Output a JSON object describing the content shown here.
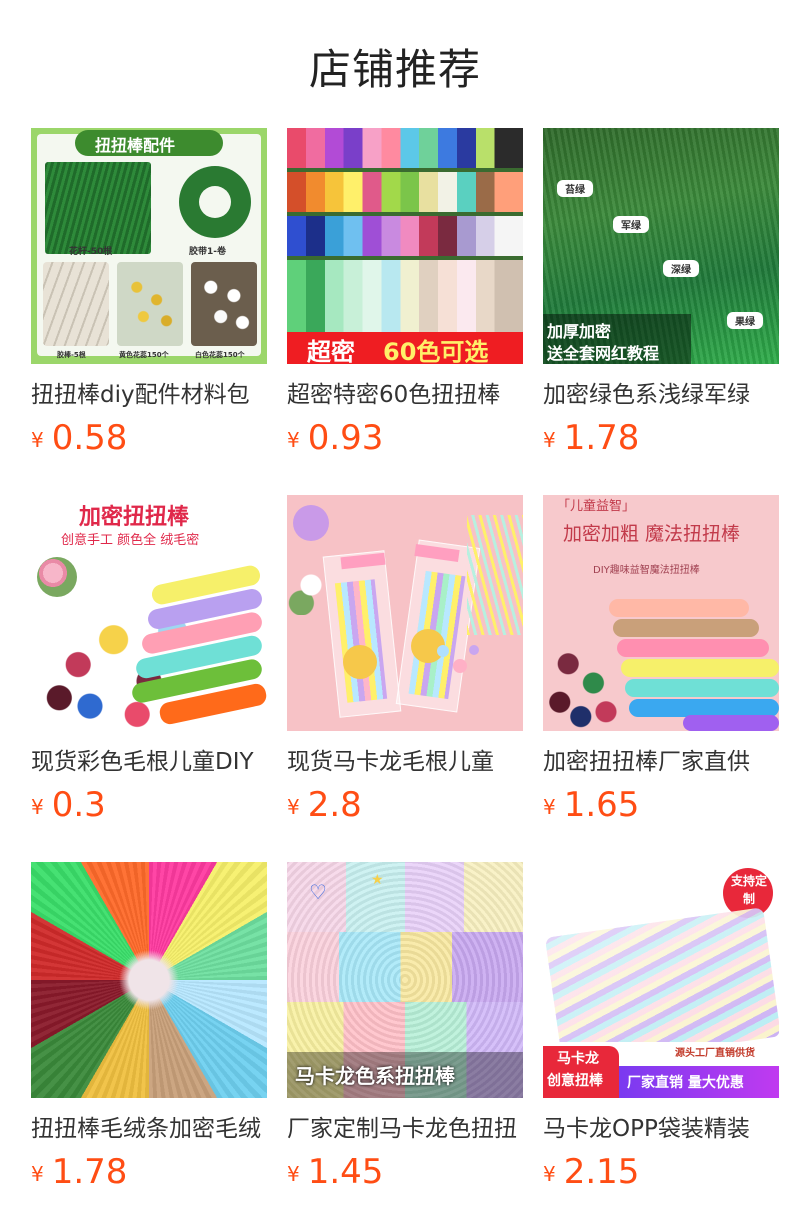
{
  "header": {
    "title": "店铺推荐"
  },
  "products": [
    {
      "name": "扭扭棒diy配件材料包",
      "currency": "¥",
      "price": "0.58",
      "image": {
        "icon": "floral-accessories-image",
        "texts": [
          "扭扭棒配件",
          "花杆-50根",
          "胶带1-卷",
          "胶棒-5根",
          "黄色花蕊150个",
          "白色花蕊150个"
        ]
      }
    },
    {
      "name": "超密特密60色扭扭棒",
      "currency": "¥",
      "price": "0.93",
      "image": {
        "icon": "sixty-color-pipe-cleaners-image",
        "texts": [
          "超密",
          "60色可选"
        ]
      }
    },
    {
      "name": "加密绿色系浅绿军绿",
      "currency": "¥",
      "price": "1.78",
      "image": {
        "icon": "green-pipe-cleaners-image",
        "texts": [
          "苔绿",
          "军绿",
          "深绿",
          "果绿",
          "加厚加密",
          "送全套网红教程"
        ]
      }
    },
    {
      "name": "现货彩色毛根儿童DIY",
      "currency": "¥",
      "price": "0.3",
      "image": {
        "icon": "colorful-pipe-cleaners-image",
        "texts": [
          "加密扭扭棒",
          "创意手工  颜色全  绒毛密"
        ]
      }
    },
    {
      "name": "现货马卡龙毛根儿童",
      "currency": "¥",
      "price": "2.8",
      "image": {
        "icon": "macaron-pack-image",
        "texts": []
      }
    },
    {
      "name": "加密扭扭棒厂家直供",
      "currency": "¥",
      "price": "1.65",
      "image": {
        "icon": "magic-pipe-cleaners-image",
        "texts": [
          "「儿童益智」",
          "加密加粗  魔法扭扭棒",
          "DIY趣味益智魔法扭扭棒"
        ]
      }
    },
    {
      "name": "扭扭棒毛绒条加密毛绒",
      "currency": "¥",
      "price": "1.78",
      "image": {
        "icon": "fluffy-strips-image",
        "texts": []
      }
    },
    {
      "name": "厂家定制马卡龙色扭扭",
      "currency": "¥",
      "price": "1.45",
      "image": {
        "icon": "macaron-color-image",
        "texts": [
          "马卡龙色系扭扭棒"
        ]
      }
    },
    {
      "name": "马卡龙OPP袋装精装",
      "currency": "¥",
      "price": "2.15",
      "image": {
        "icon": "opp-bag-image",
        "texts": [
          "支持定制",
          "源头工厂直销供货",
          "马卡龙",
          "创意扭棒",
          "厂家直销 量大优惠"
        ]
      }
    }
  ],
  "colors": {
    "price": "#ff4d14",
    "title": "#222222",
    "name": "#333333"
  }
}
